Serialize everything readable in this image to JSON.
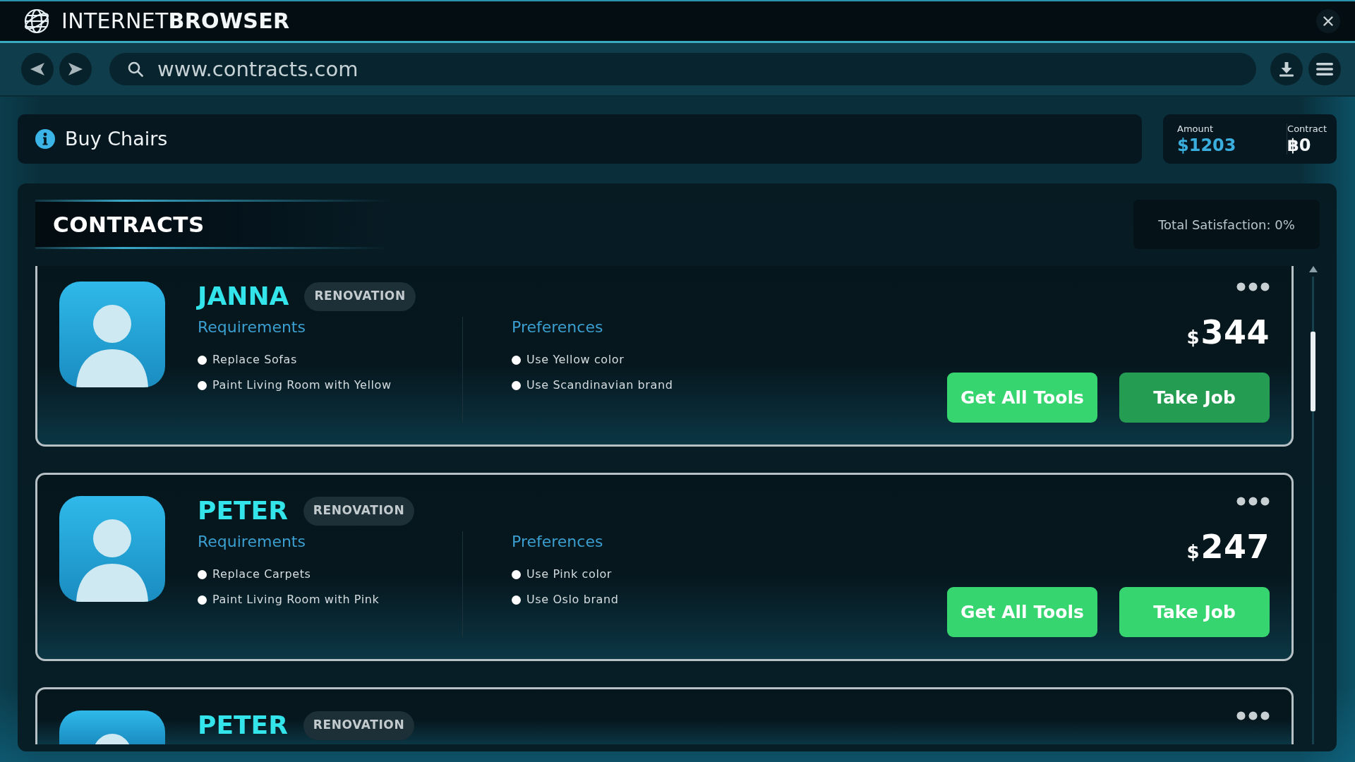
{
  "window": {
    "title": "INTERNET**BROWSER**"
  },
  "address_bar": {
    "url": "www.contracts.com"
  },
  "task": {
    "title": "Buy Chairs"
  },
  "wallet": [
    {
      "label": "Amount",
      "value": "$1203",
      "kind": "cash"
    },
    {
      "label": "Contract",
      "value": "฿0",
      "kind": "contract"
    }
  ],
  "contracts_panel": {
    "title": "CONTRACTS",
    "satisfaction": "Total Satisfaction: 0%"
  },
  "contracts": [
    {
      "name": "JANNA",
      "tag": "RENOVATION",
      "requirements": {
        "title": "Requirements",
        "items": [
          "Replace Sofas",
          "Paint Living Room with Yellow"
        ]
      },
      "preferences": {
        "title": "Preferences",
        "items": [
          "Use Yellow color",
          "Use Scandinavian brand"
        ]
      },
      "price": {
        "currency": "$",
        "amount": "344"
      },
      "buttons": [
        {
          "label": "Get All Tools",
          "pressed": false
        },
        {
          "label": "Take Job",
          "pressed": true
        }
      ]
    },
    {
      "name": "PETER",
      "tag": "RENOVATION",
      "requirements": {
        "title": "Requirements",
        "items": [
          "Replace Carpets",
          "Paint Living Room with Pink"
        ]
      },
      "preferences": {
        "title": "Preferences",
        "items": [
          "Use Pink color",
          "Use Oslo brand"
        ]
      },
      "price": {
        "currency": "$",
        "amount": "247"
      },
      "buttons": [
        {
          "label": "Get All Tools",
          "pressed": false
        },
        {
          "label": "Take Job",
          "pressed": false
        }
      ]
    },
    {
      "name": "PETER",
      "tag": "RENOVATION"
    }
  ]
}
